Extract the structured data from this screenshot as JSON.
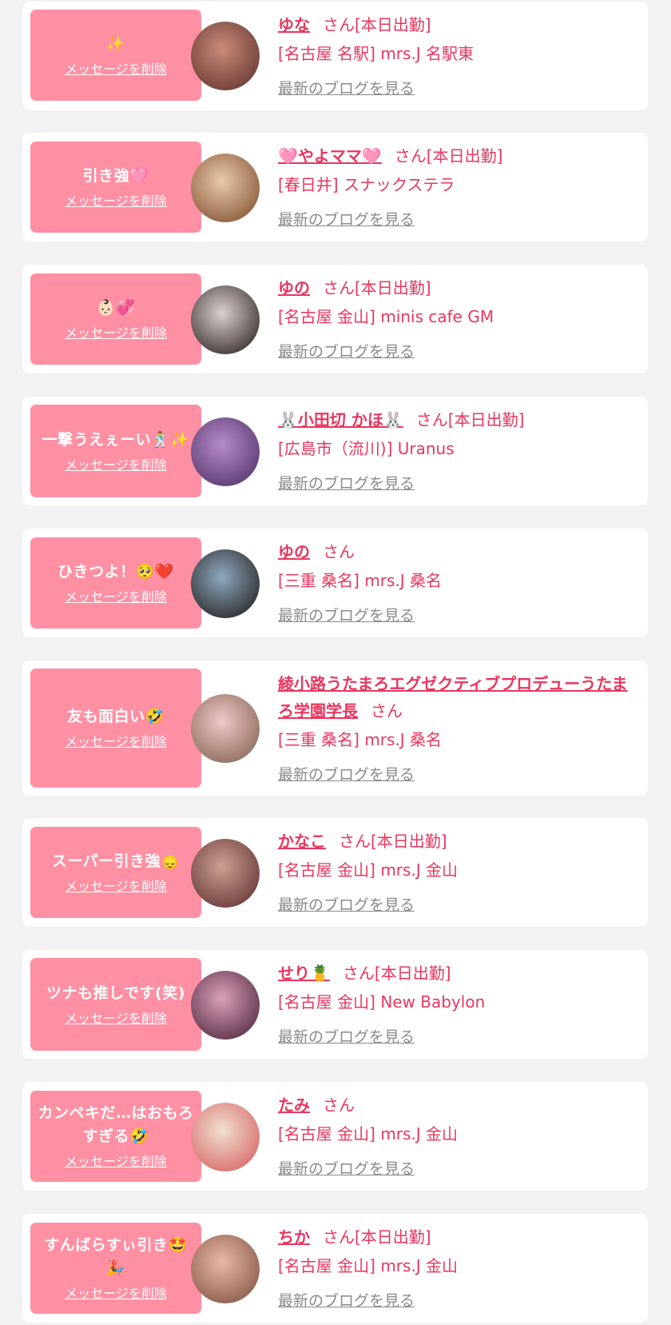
{
  "colors": {
    "page_bg": "#f2f2f2",
    "card_bg": "#ffffff",
    "bubble_bg": "#ff8fa3",
    "name_pink": "#e8365f",
    "link_gray": "#8a8a8a"
  },
  "delete_label": "メッセージを削除",
  "blog_label": "最新のブログを見る",
  "entries": [
    {
      "message": "✨",
      "name": "ゆな",
      "suffix": "さん[本日出勤]",
      "shop": "[名古屋 名駅] mrs.J 名駅東",
      "avatar_icon": "avatar-photo"
    },
    {
      "message": "引き強🩷",
      "name": "🩷やよママ🩷",
      "suffix": "さん[本日出勤]",
      "shop": "[春日井] スナックステラ",
      "avatar_icon": "avatar-photo"
    },
    {
      "message": "👶🏻💞",
      "name": "ゆの",
      "suffix": "さん[本日出勤]",
      "shop": "[名古屋 金山] minis cafe GM",
      "avatar_icon": "avatar-photo"
    },
    {
      "message": "一撃うえぇーい🕺✨",
      "name": "🐰小田切 かほ🐰",
      "suffix": "さん[本日出勤]",
      "shop": "[広島市（流川)] Uranus",
      "avatar_icon": "avatar-photo"
    },
    {
      "message": "ひきつよ！🥺❤️",
      "name": "ゆの",
      "suffix": "さん",
      "shop": "[三重 桑名] mrs.J 桑名",
      "avatar_icon": "avatar-photo"
    },
    {
      "message": "友も面白い🤣",
      "name": "綾小路うたまろエグゼクティブプロデューうたまろ学園学長",
      "suffix": "さん",
      "shop": "[三重 桑名] mrs.J 桑名",
      "avatar_icon": "avatar-photo"
    },
    {
      "message": "スーパー引き強🙂‍↕️",
      "name": "かなこ",
      "suffix": "さん[本日出勤]",
      "shop": "[名古屋 金山] mrs.J 金山",
      "avatar_icon": "avatar-photo"
    },
    {
      "message": "ツナも推しです(笑)",
      "name": "せり🍍",
      "suffix": "さん[本日出勤]",
      "shop": "[名古屋 金山] New Babylon",
      "avatar_icon": "avatar-photo"
    },
    {
      "message": "カンペキだ…はおもろすぎる🤣",
      "name": "たみ",
      "suffix": "さん",
      "shop": "[名古屋 金山] mrs.J 金山",
      "avatar_icon": "avatar-photo"
    },
    {
      "message": "すんばらすぃ引き🤩🎉",
      "name": "ちか",
      "suffix": "さん[本日出勤]",
      "shop": "[名古屋 金山] mrs.J 金山",
      "avatar_icon": "avatar-photo"
    }
  ]
}
